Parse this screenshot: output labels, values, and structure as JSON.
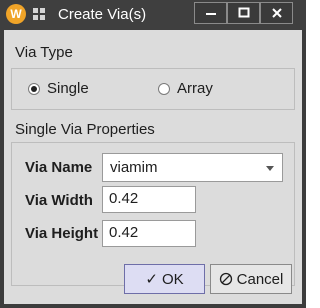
{
  "window": {
    "title": "Create Via(s)",
    "app_icon_letter": "W",
    "controls": [
      "minimize",
      "maximize",
      "close"
    ]
  },
  "via_type": {
    "label": "Via Type",
    "options": [
      {
        "label": "Single",
        "checked": true
      },
      {
        "label": "Array",
        "checked": false
      }
    ]
  },
  "props": {
    "label": "Single Via Properties",
    "name_label": "Via Name",
    "name_value": "viamim",
    "width_label": "Via Width",
    "width_value": "0.42",
    "height_label": "Via Height",
    "height_value": "0.42"
  },
  "buttons": {
    "ok_label": "OK",
    "cancel_label": "Cancel"
  },
  "colors": {
    "titlebar": "#3f3f3f",
    "dialog_bg": "#dcdcdc",
    "app_icon": "#f0a428",
    "ok_accent": "#6e6ea8"
  }
}
